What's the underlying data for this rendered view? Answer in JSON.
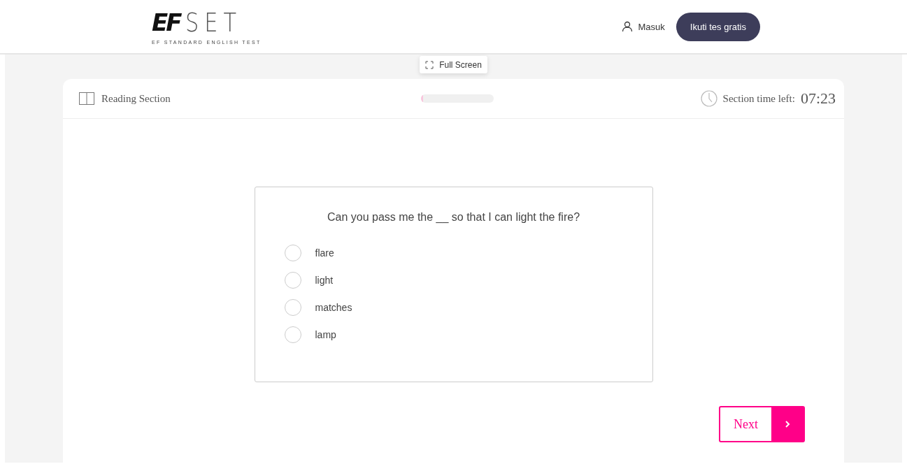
{
  "header": {
    "logo": {
      "mark": "EF",
      "word": "SET",
      "tagline": "EF STANDARD ENGLISH TEST"
    },
    "login": "Masuk",
    "cta": "Ikuti tes gratis"
  },
  "fullscreen": "Full Screen",
  "section": {
    "title": "Reading Section",
    "progress": {
      "level": 0.03
    },
    "time_label": "Section time left:",
    "time": "07:23"
  },
  "question": {
    "prompt": "Can you pass me the __ so that I can light the fire?",
    "options": [
      {
        "label": "flare",
        "selected": false
      },
      {
        "label": "light",
        "selected": false
      },
      {
        "label": "matches",
        "selected": false
      },
      {
        "label": "lamp",
        "selected": false
      }
    ]
  },
  "next": "Next"
}
